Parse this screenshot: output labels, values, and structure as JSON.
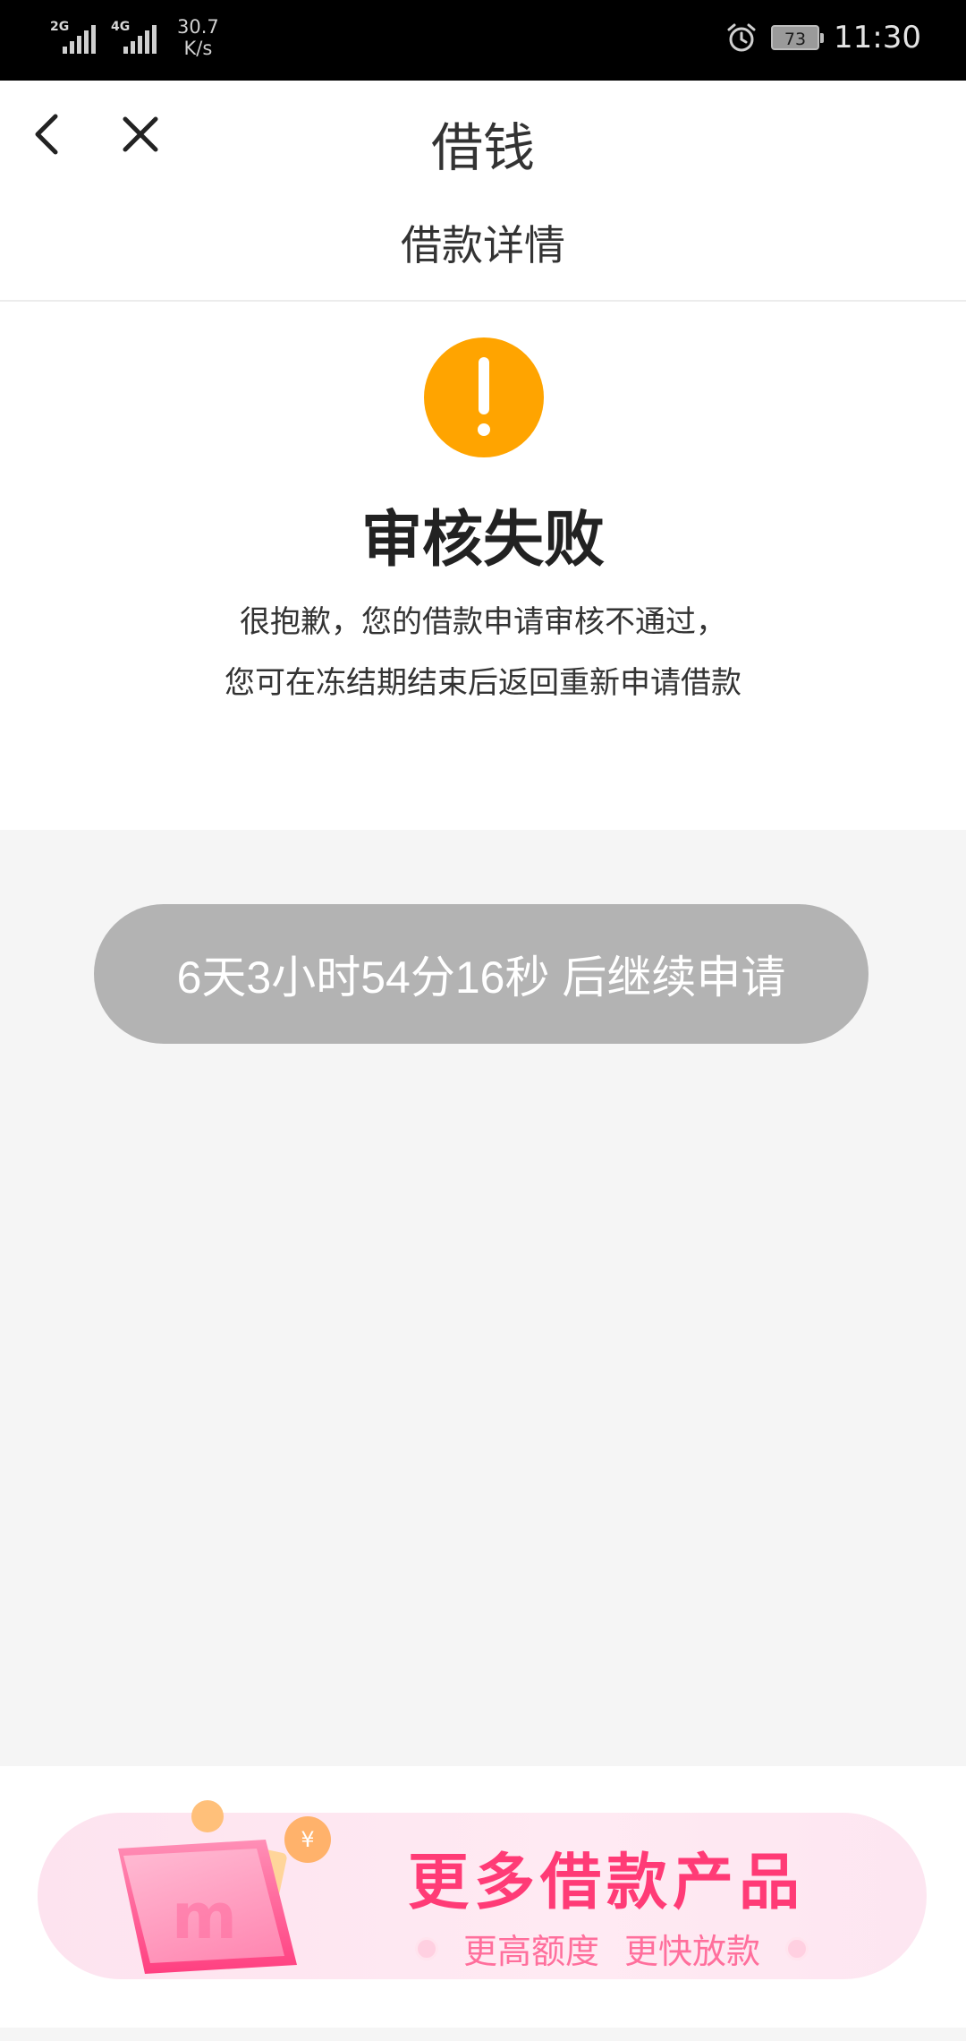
{
  "status_bar": {
    "network1": "2G",
    "network2": "4G",
    "speed_value": "30.7",
    "speed_unit": "K/s",
    "battery": "73",
    "time": "11:30"
  },
  "header": {
    "title": "借钱",
    "subtitle": "借款详情"
  },
  "result": {
    "title": "审核失败",
    "message_line1": "很抱歉，您的借款申请审核不通过，",
    "message_line2": "您可在冻结期结束后返回重新申请借款",
    "icon": "warning-icon",
    "icon_color": "#ffa400"
  },
  "countdown_button": {
    "label": "6天3小时54分16秒 后继续申请",
    "color": "#b3b3b3"
  },
  "banner": {
    "title": "更多借款产品",
    "sub1": "更高额度",
    "sub2": "更快放款",
    "accent": "#ff3b76"
  }
}
